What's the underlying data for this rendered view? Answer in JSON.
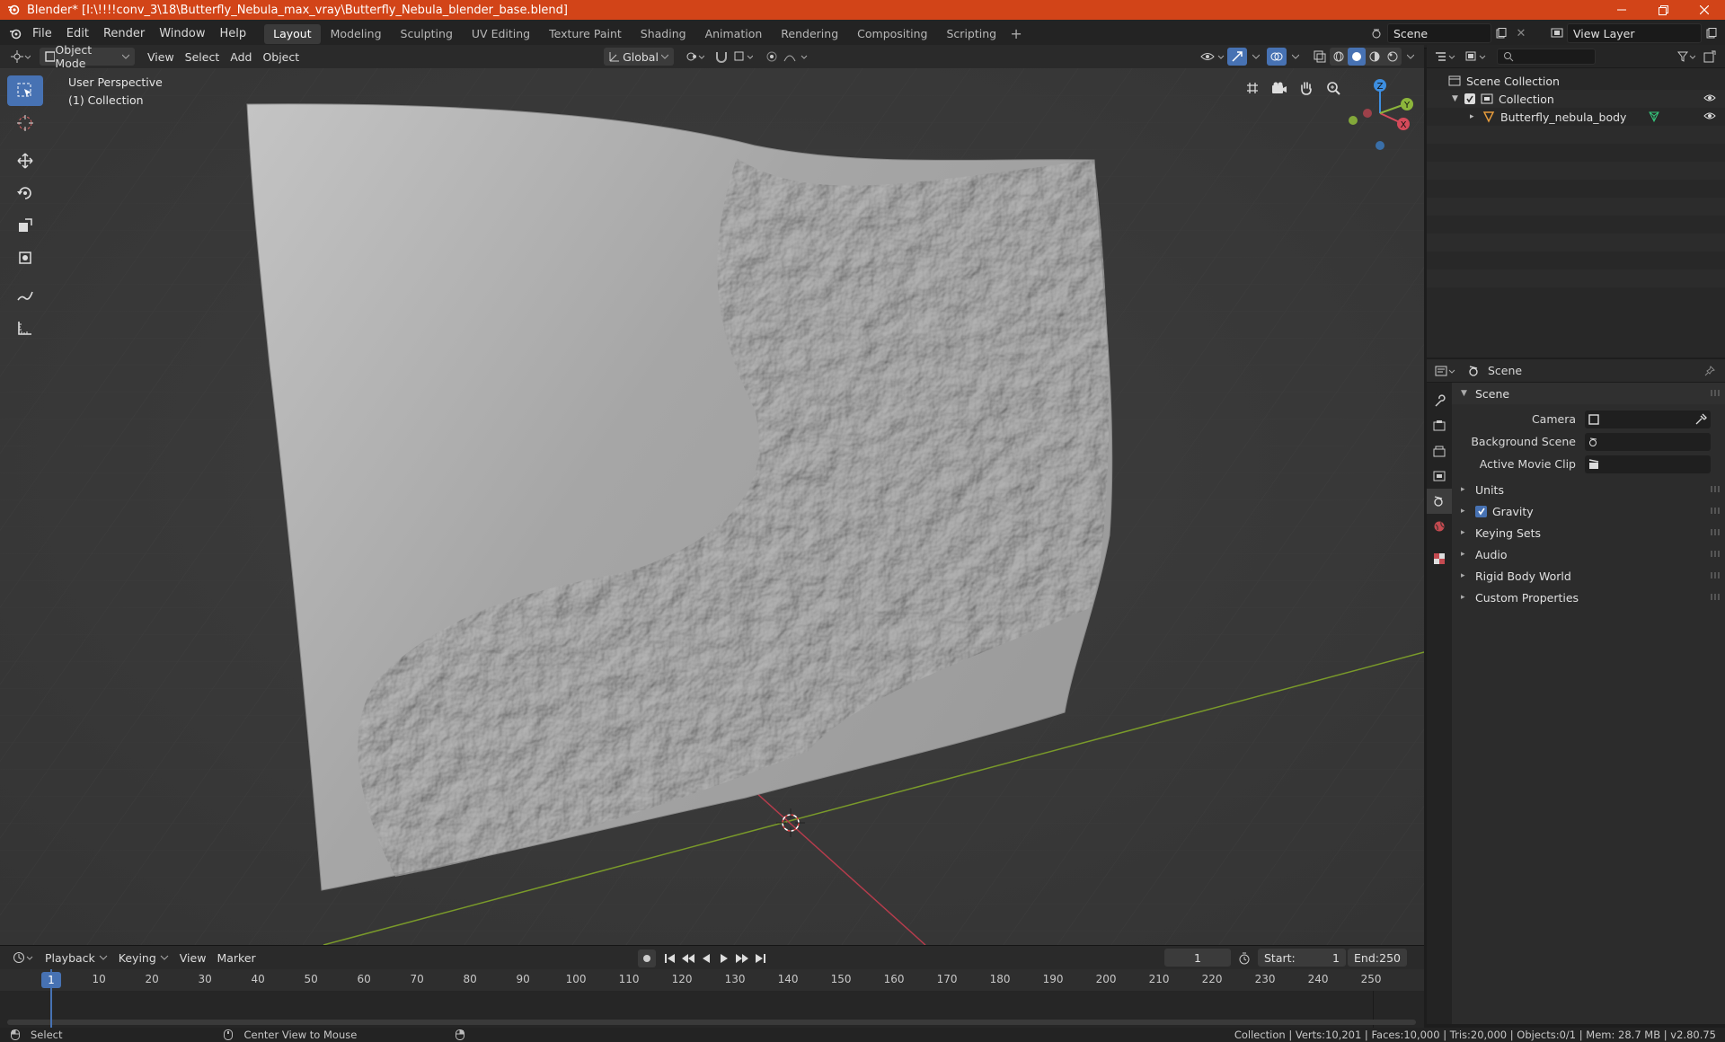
{
  "title": "Blender* [I:\\!!!!conv_3\\18\\Butterfly_Nebula_max_vray\\Butterfly_Nebula_blender_base.blend]",
  "menus": [
    "File",
    "Edit",
    "Render",
    "Window",
    "Help"
  ],
  "workspace_tabs": [
    "Layout",
    "Modeling",
    "Sculpting",
    "UV Editing",
    "Texture Paint",
    "Shading",
    "Animation",
    "Rendering",
    "Compositing",
    "Scripting"
  ],
  "active_tab": "Layout",
  "scene_field": "Scene",
  "view_layer_field": "View Layer",
  "viewport_header": {
    "mode": "Object Mode",
    "menus": [
      "View",
      "Select",
      "Add",
      "Object"
    ],
    "transform_orientation": "Global"
  },
  "viewport": {
    "perspective_label": "User Perspective",
    "collection_label": "(1) Collection",
    "gizmo": {
      "x": "X",
      "y": "Y",
      "z": "Z"
    }
  },
  "outliner": {
    "root": "Scene Collection",
    "collection": "Collection",
    "object": "Butterfly_nebula_body"
  },
  "properties": {
    "context": "Scene",
    "section": "Scene",
    "rows": [
      {
        "label": "Camera"
      },
      {
        "label": "Background Scene"
      },
      {
        "label": "Active Movie Clip"
      }
    ],
    "panels": [
      "Units",
      "Gravity",
      "Keying Sets",
      "Audio",
      "Rigid Body World",
      "Custom Properties"
    ]
  },
  "timeline": {
    "menus": [
      "Playback",
      "Keying",
      "View",
      "Marker"
    ],
    "current_frame": "1",
    "start_label": "Start:",
    "start": "1",
    "end_label": "End:",
    "end": "250",
    "ticks": [
      "1",
      "10",
      "20",
      "30",
      "40",
      "50",
      "60",
      "70",
      "80",
      "90",
      "100",
      "110",
      "120",
      "130",
      "140",
      "150",
      "160",
      "170",
      "180",
      "190",
      "200",
      "210",
      "220",
      "230",
      "240",
      "250"
    ]
  },
  "statusbar": {
    "left": "Select",
    "middle": "Center View to Mouse",
    "right": "Collection | Verts:10,201 | Faces:10,000 | Tris:20,000 | Objects:0/1 | Mem: 28.7 MB | v2.80.75"
  },
  "colors": {
    "titlebar": "#d24418",
    "accent": "#4772b3",
    "x_axis": "#d44a5a",
    "y_axis": "#8cb53b",
    "z_axis": "#3d8ee0"
  }
}
